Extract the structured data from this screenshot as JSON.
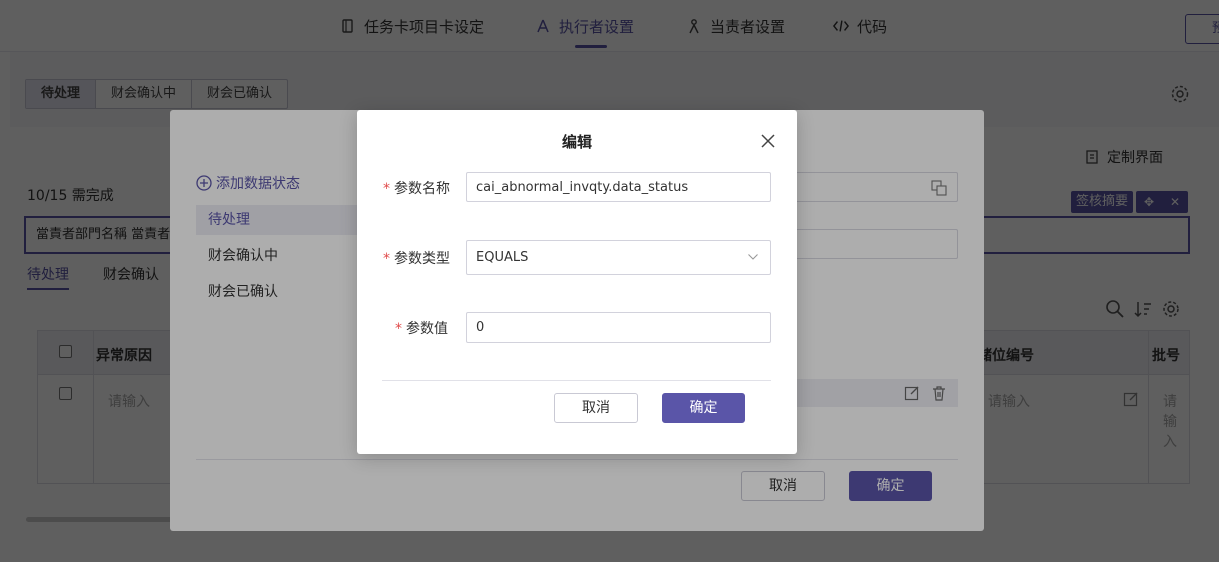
{
  "topnav": {
    "tabs": [
      {
        "label": "任务卡项目卡设定",
        "icon": "card-icon"
      },
      {
        "label": "执行者设置",
        "icon": "executor-icon"
      },
      {
        "label": "当责者设置",
        "icon": "person-icon"
      },
      {
        "label": "代码",
        "icon": "code-icon"
      }
    ],
    "preview_label": "预"
  },
  "page": {
    "segment_tabs": [
      "待处理",
      "财会确认中",
      "财会已确认"
    ],
    "progress_text": "10/15 需完成",
    "custom_ui_label": "定制界面",
    "sign_summary_label": "签核摘要",
    "responsible_fields_text": "當責者部門名稱   當責者",
    "sub_tabs": [
      "待处理",
      "财会确认"
    ],
    "table": {
      "headers": [
        "异常原因",
        "储位编号",
        "批号"
      ],
      "placeholder": "请输入"
    }
  },
  "outer_dialog": {
    "add_state_label": "添加数据状态",
    "states": [
      "待处理",
      "财会确认中",
      "财会已确认"
    ],
    "cancel_label": "取消",
    "confirm_label": "确定"
  },
  "edit_dialog": {
    "title": "编辑",
    "fields": {
      "name": {
        "label": "参数名称",
        "value": "cai_abnormal_invqty.data_status",
        "required": true
      },
      "type": {
        "label": "参数类型",
        "value": "EQUALS",
        "required": true
      },
      "value": {
        "label": "参数值",
        "value": "0",
        "required": true
      }
    },
    "required_mark": "*",
    "cancel_label": "取消",
    "confirm_label": "确定"
  },
  "colors": {
    "accent": "#5a55a8",
    "required": "#e04a4a"
  }
}
